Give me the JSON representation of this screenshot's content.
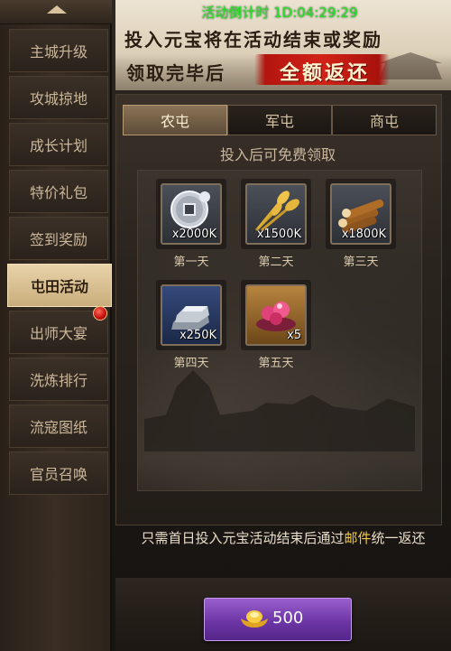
{
  "header": {
    "countdown": "活动倒计时   1D:04:29:29",
    "banner_line1": "投入元宝将在活动结束或奖励",
    "banner_line2": "领取完毕后",
    "banner_highlight": "全额返还"
  },
  "sidebar": {
    "items": [
      {
        "label": "主城升级"
      },
      {
        "label": "攻城掠地"
      },
      {
        "label": "成长计划"
      },
      {
        "label": "特价礼包"
      },
      {
        "label": "签到奖励"
      },
      {
        "label": "屯田活动"
      },
      {
        "label": "出师大宴"
      },
      {
        "label": "洗炼排行"
      },
      {
        "label": "流寇图纸"
      },
      {
        "label": "官员召唤"
      }
    ]
  },
  "tabs": [
    {
      "label": "农屯"
    },
    {
      "label": "军屯"
    },
    {
      "label": "商屯"
    }
  ],
  "main": {
    "subtitle": "投入后可免费领取",
    "rewards": [
      {
        "qty": "x2000K",
        "day": "第一天",
        "icon": "coin-icon"
      },
      {
        "qty": "x1500K",
        "day": "第二天",
        "icon": "wheat-icon"
      },
      {
        "qty": "x1800K",
        "day": "第三天",
        "icon": "wood-icon"
      },
      {
        "qty": "x250K",
        "day": "第四天",
        "icon": "iron-ingot-icon"
      },
      {
        "qty": "x5",
        "day": "第五天",
        "icon": "gift-box-icon"
      }
    ],
    "footer_prefix": "只需首日投入元宝活动结束后通过",
    "footer_highlight": "邮件",
    "footer_suffix": "统一返还"
  },
  "buy_button": {
    "amount": "500",
    "icon": "gold-ingot-icon"
  },
  "colors": {
    "countdown": "#2ae02a",
    "highlight_red": "#d22318",
    "button_purple": "#6d36a6",
    "mail_highlight": "#f2c84b"
  }
}
